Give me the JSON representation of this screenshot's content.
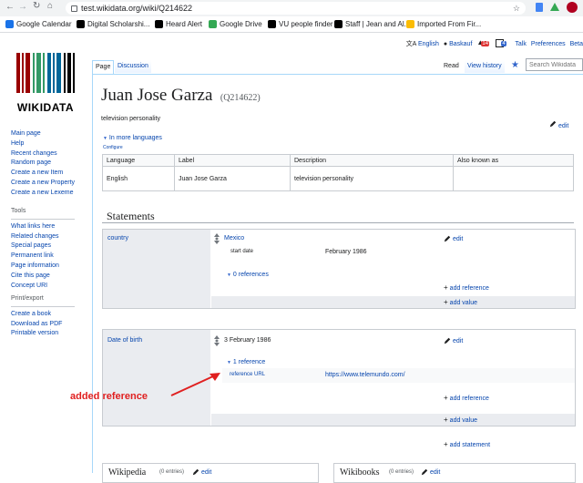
{
  "browser": {
    "url": "test.wikidata.org/wiki/Q214622",
    "bookmarks": [
      {
        "label": "Google Calendar",
        "color": "#1a73e8"
      },
      {
        "label": "Digital Scholarshi...",
        "color": "#000000"
      },
      {
        "label": "Heard Alert",
        "color": "#000000"
      },
      {
        "label": "Google Drive",
        "color": "#34a853"
      },
      {
        "label": "VU people finder",
        "color": "#000000"
      },
      {
        "label": "Staff | Jean and Al...",
        "color": "#000000"
      },
      {
        "label": "Imported From Fir...",
        "color": "#fbbc04"
      }
    ]
  },
  "personal": {
    "language": "English",
    "user": "Baskauf",
    "badge1": "14",
    "badge2": "4",
    "talk": "Talk",
    "preferences": "Preferences",
    "beta": "Beta"
  },
  "logo": {
    "wordmark": "WIKIDATA"
  },
  "tabs": {
    "page": "Page",
    "discussion": "Discussion",
    "read": "Read",
    "view_history": "View history",
    "search_placeholder": "Search Wikidata"
  },
  "nav": {
    "main": [
      "Main page",
      "Help",
      "Recent changes",
      "Random page",
      "Create a new Item",
      "Create a new Property",
      "Create a new Lexeme"
    ],
    "tools_heading": "Tools",
    "tools": [
      "What links here",
      "Related changes",
      "Special pages",
      "Permanent link",
      "Page information",
      "Cite this page",
      "Concept URI"
    ],
    "print_heading": "Print/export",
    "print": [
      "Create a book",
      "Download as PDF",
      "Printable version"
    ]
  },
  "item": {
    "title": "Juan Jose Garza",
    "qid": "(Q214622)",
    "description": "television personality",
    "edit": "edit",
    "more_languages": "In more languages",
    "configure": "Configure"
  },
  "lang_table": {
    "headers": [
      "Language",
      "Label",
      "Description",
      "Also known as"
    ],
    "row": [
      "English",
      "Juan Jose Garza",
      "television personality",
      ""
    ]
  },
  "statements": {
    "heading": "Statements",
    "country": {
      "property": "country",
      "value": "Mexico",
      "qualifier_prop": "start date",
      "qualifier_val": "February 1986",
      "references": "0 references",
      "edit": "edit",
      "add_reference": "add reference",
      "add_value": "add value"
    },
    "dob": {
      "property": "Date of birth",
      "value": "3 February 1986",
      "references": "1 reference",
      "ref_prop": "reference URL",
      "ref_val": "https://www.telemundo.com/",
      "edit": "edit",
      "add_reference": "add reference",
      "add_value": "add value"
    },
    "add_statement": "add statement"
  },
  "annotation": {
    "text": "added reference",
    "color": "#e02020"
  },
  "sitelinks": {
    "left_title": "Wikipedia",
    "left_count": "(0 entries)",
    "left_edit": "edit",
    "right_title": "Wikibooks",
    "right_count": "(0 entries)",
    "right_edit": "edit"
  }
}
